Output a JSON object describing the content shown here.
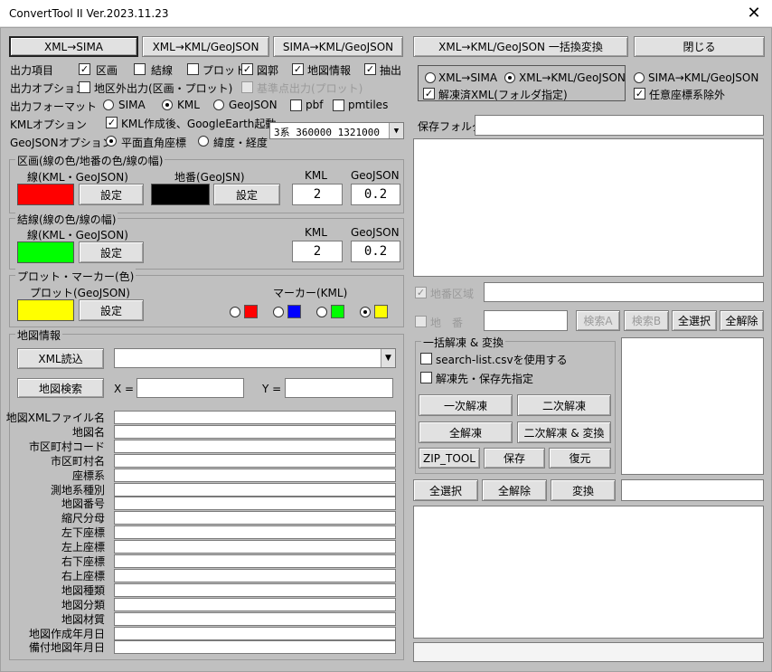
{
  "window": {
    "title": "ConvertTool II  Ver.2023.11.23",
    "close_glyph": "✕"
  },
  "top_buttons": {
    "xml_sima": "XML→SIMA",
    "xml_kml_geojson": "XML→KML/GeoJSON",
    "sima_kml_geojson": "SIMA→KML/GeoJSON",
    "batch": "XML→KML/GeoJSON 一括換変換",
    "close": "閉じる"
  },
  "output_items": {
    "label": "出力項目",
    "items": [
      "区画",
      "結線",
      "プロット",
      "図郭",
      "地図情報",
      "抽出"
    ]
  },
  "output_options": {
    "label": "出力オプション",
    "outside": "地区外出力(区画・プロット)",
    "datum_point": "基準点出力(プロット)"
  },
  "output_format": {
    "label": "出力フォーマット",
    "options": [
      "SIMA",
      "KML",
      "GeoJSON",
      "pbf",
      "pmtiles"
    ]
  },
  "kml_option": {
    "label": "KMLオプション",
    "text": "KML作成後、GoogleEarth起動"
  },
  "geojson_option": {
    "label": "GeoJSONオプション",
    "plane": "平面直角座標",
    "latlon": "緯度・経度",
    "crs": "3系 360000 1321000"
  },
  "parcel_group": {
    "title": "区画(線の色/地番の色/線の幅)",
    "line_label": "線(KML・GeoJSON)",
    "lot_label": "地番(GeoJSN)",
    "set": "設定",
    "kml_label": "KML",
    "geojson_label": "GeoJSON",
    "kml_width": "2",
    "geojson_width": "0.2",
    "line_color": "#ff0000",
    "lot_color": "#000000"
  },
  "link_group": {
    "title": "結線(線の色/線の幅)",
    "line_label": "線(KML・GeoJSON)",
    "set": "設定",
    "kml_label": "KML",
    "geojson_label": "GeoJSON",
    "kml_width": "2",
    "geojson_width": "0.2",
    "line_color": "#00ff00"
  },
  "plot_group": {
    "title": "プロット・マーカー(色)",
    "plot_label": "プロット(GeoJSON)",
    "set": "設定",
    "marker_label": "マーカー(KML)",
    "plot_color": "#ffff00",
    "markers": [
      "#ff0000",
      "#0000ff",
      "#00ff00",
      "#ffff00"
    ]
  },
  "map_info": {
    "title": "地図情報",
    "xml_read": "XML読込",
    "map_search": "地図検索",
    "x_label": "X =",
    "y_label": "Y =",
    "fields": [
      "地図XMLファイル名",
      "地図名",
      "市区町村コード",
      "市区町村名",
      "座標系",
      "測地系種別",
      "地図番号",
      "縮尺分母",
      "左下座標",
      "左上座標",
      "右下座標",
      "右上座標",
      "地図種類",
      "地図分類",
      "地図材質",
      "地図作成年月日",
      "備付地図年月日"
    ]
  },
  "mode": {
    "xml_sima": "XML→SIMA",
    "xml_kml": "XML→KML/GeoJSON",
    "sima_kml": "SIMA→KML/GeoJSON",
    "unzipped": "解凍済XML(フォルダ指定)",
    "arbitrary": "任意座標系除外"
  },
  "save_folder": {
    "label": "保存フォルダ"
  },
  "filter": {
    "area": "地番区域",
    "lot": "地　番",
    "search_a": "検索A",
    "search_b": "検索B",
    "select_all": "全選択",
    "deselect_all": "全解除"
  },
  "batch_group": {
    "title": "一括解凍 & 変換",
    "use_list": "search-list.csvを使用する",
    "specify_dest": "解凍先・保存先指定",
    "first": "一次解凍",
    "second": "二次解凍",
    "all": "全解凍",
    "second_convert": "二次解凍 & 変換",
    "zip": "ZIP_TOOL",
    "save": "保存",
    "restore": "復元"
  },
  "bottom": {
    "select_all": "全選択",
    "deselect_all": "全解除",
    "convert": "変換"
  }
}
